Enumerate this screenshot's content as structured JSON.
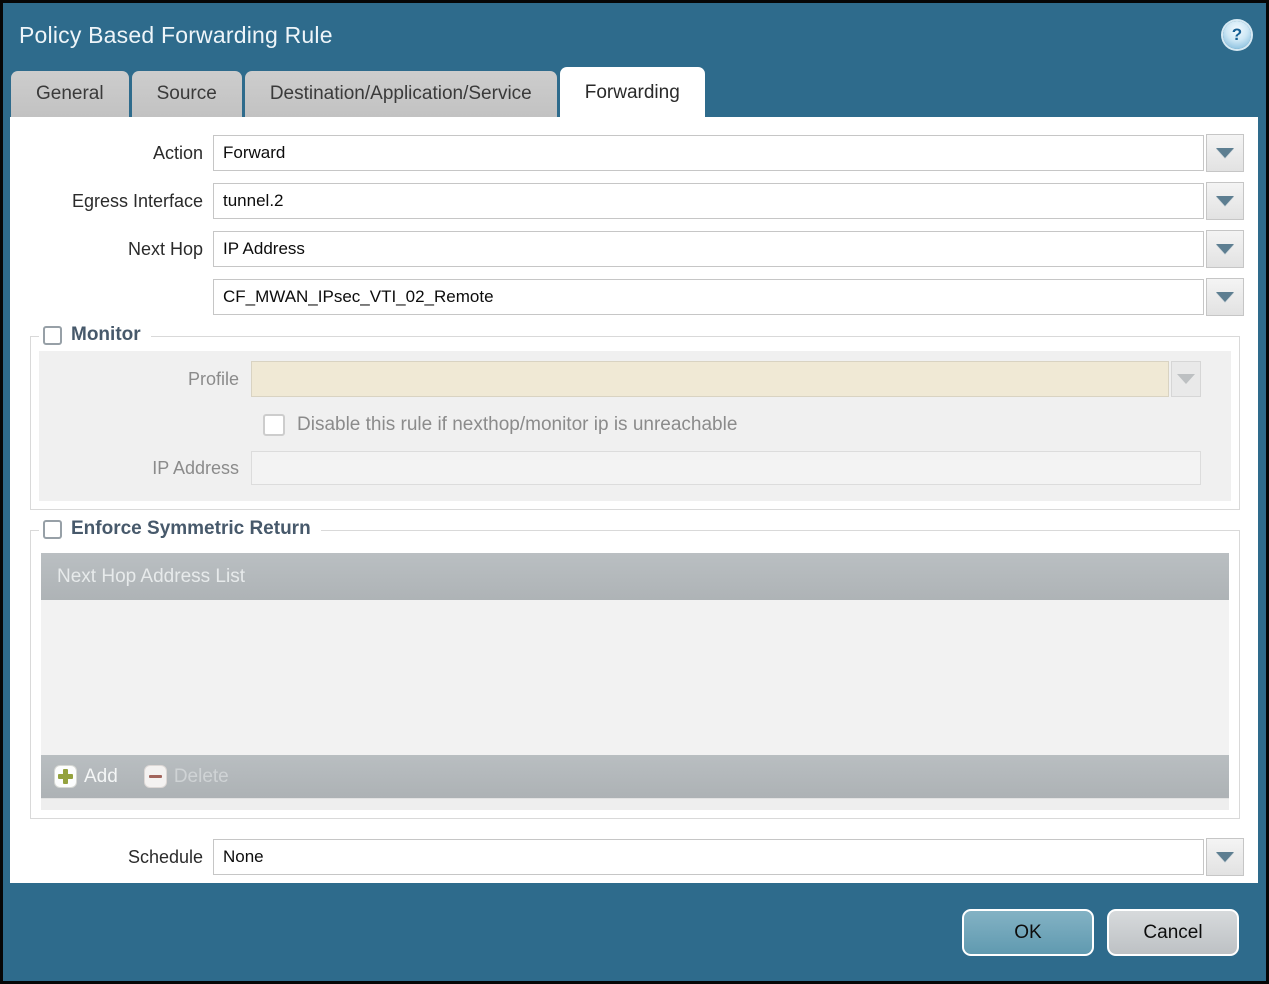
{
  "dialog": {
    "title": "Policy Based Forwarding Rule",
    "help_icon_glyph": "?"
  },
  "tabs": [
    {
      "label": "General",
      "active": false
    },
    {
      "label": "Source",
      "active": false
    },
    {
      "label": "Destination/Application/Service",
      "active": false
    },
    {
      "label": "Forwarding",
      "active": true
    }
  ],
  "form": {
    "action": {
      "label": "Action",
      "value": "Forward"
    },
    "egress_interface": {
      "label": "Egress Interface",
      "value": "tunnel.2"
    },
    "next_hop": {
      "label": "Next Hop",
      "value": "IP Address"
    },
    "next_hop_address": {
      "value": "CF_MWAN_IPsec_VTI_02_Remote"
    },
    "schedule": {
      "label": "Schedule",
      "value": "None"
    }
  },
  "monitor": {
    "legend": "Monitor",
    "checked": false,
    "profile": {
      "label": "Profile",
      "value": ""
    },
    "disable_rule_checkbox": {
      "label": "Disable this rule if nexthop/monitor ip is unreachable",
      "checked": false,
      "enabled": false
    },
    "ip_address": {
      "label": "IP Address",
      "value": ""
    }
  },
  "symmetric_return": {
    "legend": "Enforce Symmetric Return",
    "checked": false,
    "table": {
      "header": "Next Hop Address List",
      "rows": []
    },
    "add_label": "Add",
    "delete_label": "Delete",
    "delete_enabled": false
  },
  "footer": {
    "ok_label": "OK",
    "cancel_label": "Cancel"
  },
  "colors": {
    "dialog_background": "#2e6b8c",
    "active_tab": "#ffffff",
    "inactive_tab": "#c6c6c6",
    "fieldset_legend_text": "#47596b",
    "disabled_field_beige": "#f0e9d5",
    "table_header_gray": "#b3b8bb",
    "add_icon_green": "#94a23e",
    "delete_icon_red": "#a2655c",
    "ok_button": "#6ca4b9",
    "cancel_button": "#c9cdd0"
  }
}
